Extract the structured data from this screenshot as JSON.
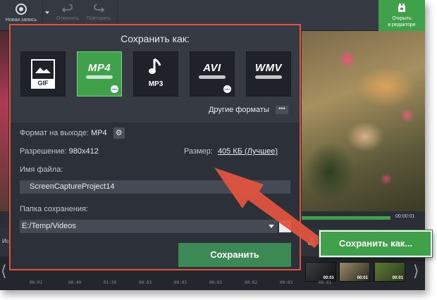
{
  "toolbar": {
    "new_recording": "Новая запись",
    "undo": "Отменить",
    "redo": "Повторить",
    "open_editor_line1": "Открыть",
    "open_editor_line2": "в редакторе"
  },
  "dialog": {
    "title": "Сохранить как:",
    "formats": [
      {
        "name": "GIF",
        "icon": "gif-icon"
      },
      {
        "name": "MP4",
        "icon": "mp4-icon",
        "selected": true
      },
      {
        "name": "MP3",
        "icon": "music-note-icon"
      },
      {
        "name": "AVI",
        "icon": "avi-icon"
      },
      {
        "name": "WMV",
        "icon": "wmv-icon"
      }
    ],
    "other_formats": "Другие форматы",
    "other_formats_btn": "•••",
    "output_format_label": "Формат на выходе:",
    "output_format_value": "MP4",
    "resolution_label": "Разрешение:",
    "resolution_value": "980x412",
    "size_label": "Размер:",
    "size_value": "405 КБ (Лучшее)",
    "filename_label": "Имя файла:",
    "filename_value": "ScreenCaptureProject14",
    "folder_label": "Папка сохранения:",
    "folder_value": "E:/Temp/Videos",
    "browse_btn": "•••",
    "save_button": "Сохранить"
  },
  "player": {
    "time": "00:00:01",
    "left_label": "Ис"
  },
  "timeline": {
    "ticks": [
      "00:01",
      "00:49",
      "01:39",
      "00:03",
      "00:03",
      "00:02",
      "00:02",
      "00:03",
      "00:01"
    ],
    "thumb_times": [
      "00:01",
      "00:01",
      "00:03",
      "00:01"
    ]
  },
  "callout": {
    "label": "Сохранить как..."
  },
  "colors": {
    "accent_green": "#3fa14a",
    "dialog_border": "#e0533f",
    "arrow": "#e0533f"
  }
}
